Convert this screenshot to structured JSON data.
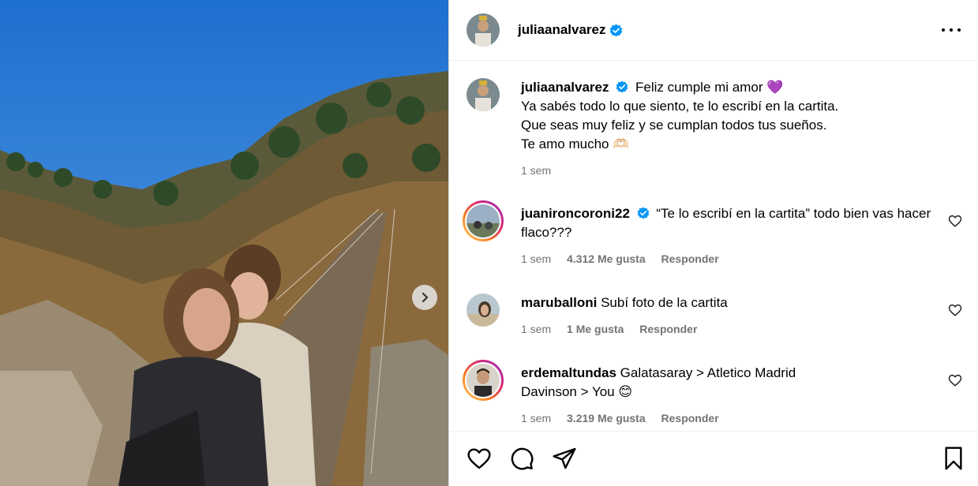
{
  "post": {
    "author": "juliaanalvarez",
    "caption_lines": [
      "Feliz cumple mi amor 💜",
      "Ya sabés todo lo que siento, te lo escribí en la cartita.",
      "Que seas muy feliz y se cumplan todos tus sueños.",
      "Te amo mucho 🫶🏻"
    ],
    "caption_time": "1 sem"
  },
  "comments": [
    {
      "username": "juanironcoroni22",
      "text": "“Te lo escribí en la cartita” todo bien vas hacer flaco???",
      "time": "1 sem",
      "likes": "4.312 Me gusta",
      "reply": "Responder"
    },
    {
      "username": "maruballoni",
      "text": "Subí foto de la cartita",
      "time": "1 sem",
      "likes": "1 Me gusta",
      "reply": "Responder"
    },
    {
      "username": "erdemaltundas",
      "text_line1": "Galatasaray > Atletico Madrid",
      "text_line2": "Davinson > You 😊",
      "time": "1 sem",
      "likes": "3.219 Me gusta",
      "reply": "Responder"
    }
  ],
  "icons": {
    "verified": "verified-badge-icon",
    "more": "more-options-icon",
    "like": "heart-icon",
    "comment": "comment-icon",
    "share": "share-icon",
    "save": "bookmark-icon",
    "next": "chevron-right-icon"
  },
  "colors": {
    "verified": "#0095f6",
    "meta": "#737373",
    "border": "#dbdbdb"
  }
}
